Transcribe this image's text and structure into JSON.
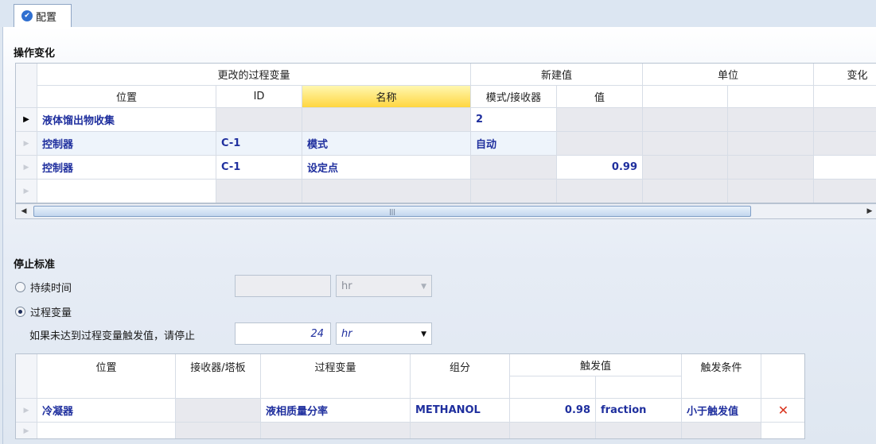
{
  "tab": {
    "label": "配置"
  },
  "sections": {
    "operation_changes": "操作变化",
    "stop_criteria": "停止标准"
  },
  "ops_grid": {
    "group_headers": [
      "更改的过程变量",
      "新建值",
      "单位",
      "变化"
    ],
    "columns": [
      "位置",
      "ID",
      "名称",
      "模式/接收器",
      "值"
    ],
    "rows": [
      {
        "location": "液体馏出物收集",
        "id": "",
        "name": "",
        "mode": "2",
        "value": ""
      },
      {
        "location": "控制器",
        "id": "C-1",
        "name": "模式",
        "mode": "自动",
        "value": ""
      },
      {
        "location": "控制器",
        "id": "C-1",
        "name": "设定点",
        "mode": "",
        "value": "0.99"
      }
    ]
  },
  "stop": {
    "duration_label": "持续时间",
    "duration_unit": "hr",
    "procvar_label": "过程变量",
    "stop_if_label": "如果未达到过程变量触发值，请停止",
    "stop_if_value": "24",
    "stop_if_unit": "hr"
  },
  "trigger_grid": {
    "columns": [
      "位置",
      "接收器/塔板",
      "过程变量",
      "组分",
      "触发值",
      "触发条件"
    ],
    "rows": [
      {
        "location": "冷凝器",
        "receiver": "",
        "procvar": "液相质量分率",
        "component": "METHANOL",
        "trigger_value": "0.98",
        "trigger_unit": "fraction",
        "condition": "小于触发值"
      }
    ]
  }
}
